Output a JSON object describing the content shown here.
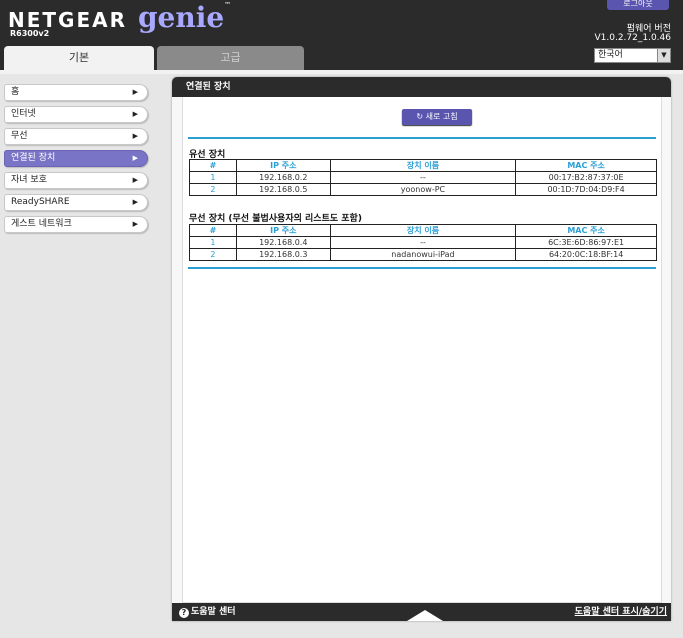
{
  "header": {
    "brand_name": "NETGEAR",
    "brand_product": "genie",
    "brand_tm": "™",
    "model": "R6300v2",
    "logout_label": "로그아웃",
    "firmware_label": "펌웨어 버전",
    "firmware_version": "V1.0.2.72_1.0.46",
    "language_value": "한국어",
    "tabs": [
      {
        "label": "기본",
        "active": true
      },
      {
        "label": "고급",
        "active": false
      }
    ]
  },
  "sidebar": {
    "items": [
      {
        "label": "홈",
        "active": false
      },
      {
        "label": "인터넷",
        "active": false
      },
      {
        "label": "무선",
        "active": false
      },
      {
        "label": "연결된 장치",
        "active": true
      },
      {
        "label": "자녀 보호",
        "active": false
      },
      {
        "label": "ReadySHARE",
        "active": false
      },
      {
        "label": "게스트 네트워크",
        "active": false
      }
    ]
  },
  "panel": {
    "title": "연결된 장치",
    "refresh_label": "새로 고침",
    "columns": [
      "#",
      "IP 주소",
      "장치 이름",
      "MAC 주소"
    ],
    "wired": {
      "title": "유선 장치",
      "rows": [
        {
          "num": "1",
          "ip": "192.168.0.2",
          "name": "--",
          "mac": "00:17:B2:87:37:0E"
        },
        {
          "num": "2",
          "ip": "192.168.0.5",
          "name": "yoonow-PC",
          "mac": "00:1D:7D:04:D9:F4"
        }
      ]
    },
    "wireless": {
      "title": "무선 장치 (무선 불법사용자의 리스트도 포함)",
      "rows": [
        {
          "num": "1",
          "ip": "192.168.0.4",
          "name": "--",
          "mac": "6C:3E:6D:86:97:E1"
        },
        {
          "num": "2",
          "ip": "192.168.0.3",
          "name": "nadanowui-iPad",
          "mac": "64:20:0C:18:BF:14"
        }
      ]
    }
  },
  "footer": {
    "help_center": "도움말 센터",
    "help_toggle": "도움말 센터 표시/숨기기"
  },
  "colors": {
    "accent_purple": "#7a74c6",
    "link_blue": "#2a9fd6",
    "header_dark": "#2b2b2b"
  }
}
